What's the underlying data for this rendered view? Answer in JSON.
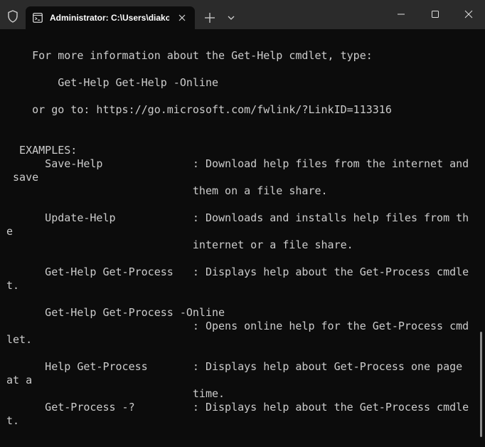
{
  "window": {
    "tab_title": "Administrator: C:\\Users\\diako",
    "icons": {
      "shield": "shield-icon",
      "tab": "terminal-icon",
      "tab_close": "close-icon",
      "new_tab": "plus-icon",
      "dropdown": "chevron-down-icon",
      "minimize": "minimize-icon",
      "maximize": "maximize-icon",
      "close": "close-icon"
    },
    "colors": {
      "titlebar": "#2b2b2b",
      "background": "#0c0c0c",
      "text": "#cccccc"
    }
  },
  "terminal": {
    "lines": [
      "    For more information about the Get-Help cmdlet, type:",
      "",
      "        Get-Help Get-Help -Online",
      "",
      "    or go to: https://go.microsoft.com/fwlink/?LinkID=113316",
      "",
      "",
      "  EXAMPLES:",
      "      Save-Help              : Download help files from the internet and",
      " save",
      "                             them on a file share.",
      "",
      "      Update-Help            : Downloads and installs help files from th",
      "e",
      "                             internet or a file share.",
      "",
      "      Get-Help Get-Process   : Displays help about the Get-Process cmdle",
      "t.",
      "",
      "      Get-Help Get-Process -Online",
      "                             : Opens online help for the Get-Process cmd",
      "let.",
      "",
      "      Help Get-Process       : Displays help about Get-Process one page",
      "at a",
      "                             time.",
      "      Get-Process -?         : Displays help about the Get-Process cmdle",
      "t."
    ]
  }
}
